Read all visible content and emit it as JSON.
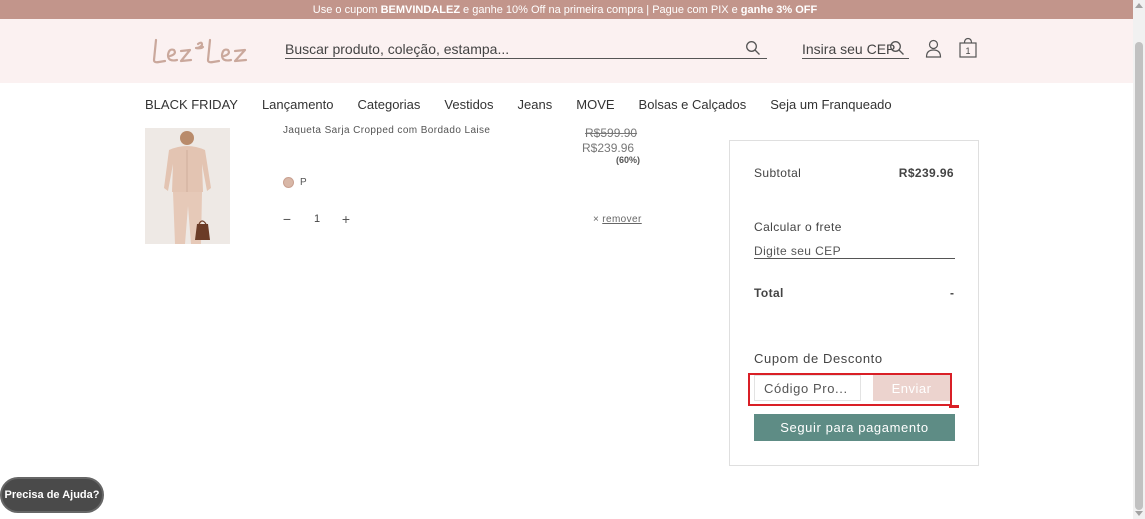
{
  "promo_bar": {
    "text_1": "Use o cupom",
    "code": "BEMVINDALEZ",
    "text_2": "e ganhe 10% Off na primeira compra | Pague com PIX e",
    "bold_2": "ganhe 3% OFF"
  },
  "header": {
    "logo": "lez a lez",
    "search_placeholder": "Buscar produto, coleção, estampa...",
    "cep_label": "Insira seu CEP",
    "cart_count": "1"
  },
  "nav": {
    "items": [
      {
        "label": "BLACK FRIDAY"
      },
      {
        "label": "Lançamento"
      },
      {
        "label": "Categorias"
      },
      {
        "label": "Vestidos"
      },
      {
        "label": "Jeans"
      },
      {
        "label": "MOVE"
      },
      {
        "label": "Bolsas e Calçados"
      },
      {
        "label": "Seja um Franqueado"
      }
    ]
  },
  "cart_item": {
    "name": "Jaqueta Sarja Cropped com Bordado Laise",
    "old_price": "R$599.90",
    "new_price": "R$239.96",
    "discount": "(60%)",
    "size": "P",
    "quantity": "1",
    "remove_x": "×",
    "remove_label": "remover"
  },
  "summary": {
    "subtotal_label": "Subtotal",
    "subtotal_value": "R$239.96",
    "frete_label": "Calcular o frete",
    "frete_placeholder": "Digite seu CEP",
    "total_label": "Total",
    "total_value": "-",
    "cupom_label": "Cupom de Desconto",
    "cupom_placeholder": "Código Pro...",
    "cupom_button": "Enviar",
    "pay_button": "Seguir para pagamento"
  },
  "help_button": "Precisa de Ajuda?",
  "colors": {
    "promo_bar": "#c2958b",
    "header_bg": "#fbf1f1",
    "pay_button": "#5e8c85",
    "cupom_button": "#ecd3ce",
    "highlight": "#d91f26"
  }
}
